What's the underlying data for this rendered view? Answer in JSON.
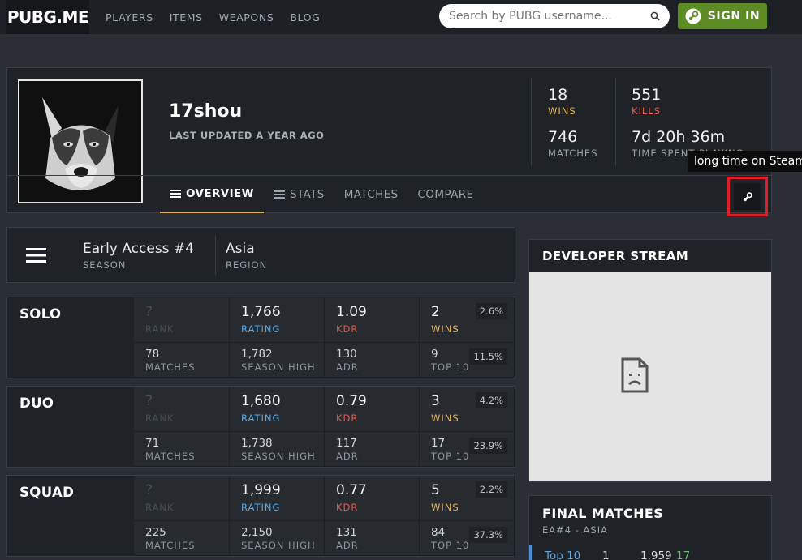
{
  "topbar": {
    "logo": "PUBG.ME",
    "nav": [
      "PLAYERS",
      "ITEMS",
      "WEAPONS",
      "BLOG"
    ],
    "search_placeholder": "Search by PUBG username...",
    "signin_label": "SIGN IN"
  },
  "profile": {
    "username": "17shou",
    "updated": "LAST UPDATED A YEAR AGO",
    "stats": [
      {
        "value": "18",
        "label": "WINS",
        "color": "#e7b85b"
      },
      {
        "value": "551",
        "label": "KILLS",
        "color": "#e05a4e"
      },
      {
        "value": "746",
        "label": "MATCHES",
        "color": "#9aa1a8"
      },
      {
        "value": "7d 20h 36m",
        "label": "TIME SPENT PLAYING",
        "color": "#9aa1a8"
      }
    ],
    "tabs": [
      "OVERVIEW",
      "STATS",
      "MATCHES",
      "COMPARE"
    ],
    "active_tab": "OVERVIEW",
    "tooltip": "long time on Steam"
  },
  "season": {
    "season_value": "Early Access #4",
    "season_label": "SEASON",
    "region_value": "Asia",
    "region_label": "REGION"
  },
  "modes": [
    {
      "name": "SOLO",
      "rank": "?",
      "rank_label": "RANK",
      "rating": "1,766",
      "rating_label": "RATING",
      "kdr": "1.09",
      "kdr_label": "KDR",
      "wins": "2",
      "wins_label": "WINS",
      "wins_pct": "2.6%",
      "matches": "78",
      "matches_label": "MATCHES",
      "season_high": "1,782",
      "season_high_label": "SEASON HIGH",
      "adr": "130",
      "adr_label": "ADR",
      "top10": "9",
      "top10_label": "TOP 10",
      "top10_pct": "11.5%"
    },
    {
      "name": "DUO",
      "rank": "?",
      "rank_label": "RANK",
      "rating": "1,680",
      "rating_label": "RATING",
      "kdr": "0.79",
      "kdr_label": "KDR",
      "wins": "3",
      "wins_label": "WINS",
      "wins_pct": "4.2%",
      "matches": "71",
      "matches_label": "MATCHES",
      "season_high": "1,738",
      "season_high_label": "SEASON HIGH",
      "adr": "117",
      "adr_label": "ADR",
      "top10": "17",
      "top10_label": "TOP 10",
      "top10_pct": "23.9%"
    },
    {
      "name": "SQUAD",
      "rank": "?",
      "rank_label": "RANK",
      "rating": "1,999",
      "rating_label": "RATING",
      "kdr": "0.77",
      "kdr_label": "KDR",
      "wins": "5",
      "wins_label": "WINS",
      "wins_pct": "2.2%",
      "matches": "225",
      "matches_label": "MATCHES",
      "season_high": "2,150",
      "season_high_label": "SEASON HIGH",
      "adr": "131",
      "adr_label": "ADR",
      "top10": "84",
      "top10_label": "TOP 10",
      "top10_pct": "37.3%"
    }
  ],
  "sidebar": {
    "dev_stream_title": "DEVELOPER STREAM",
    "final_matches_title": "FINAL MATCHES",
    "final_matches_sub": "EA#4 - ASIA",
    "first_match": {
      "place": "Top 10",
      "kills": "1",
      "rating": "1,959",
      "delta": "17"
    }
  },
  "colors": {
    "rating_label": "#5aa9e6",
    "kdr_label": "#e05a4e",
    "wins_label": "#e7b85b",
    "muted_label": "#8d949b",
    "rank_dim": "#4a4f56",
    "accent_tab": "#e7a94d",
    "signin_green": "#5d8b24",
    "highlight_red": "#e01e2a"
  }
}
